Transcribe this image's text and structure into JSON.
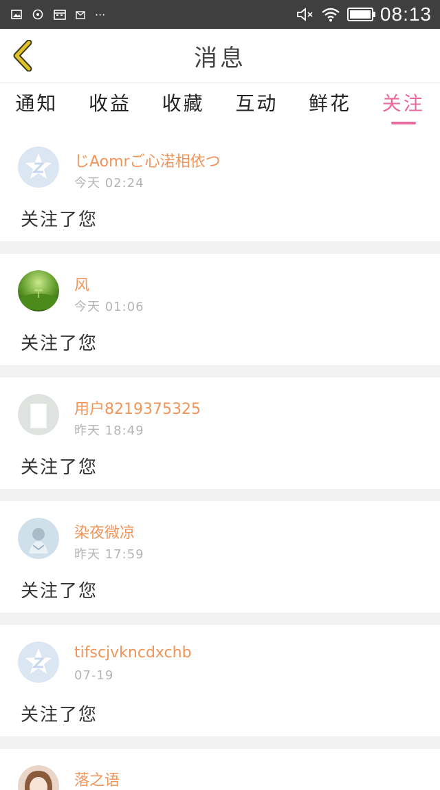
{
  "status_bar": {
    "time": "08:13",
    "left_more": "···"
  },
  "header": {
    "title": "消息"
  },
  "tabs": [
    {
      "label": "通知"
    },
    {
      "label": "收益"
    },
    {
      "label": "收藏"
    },
    {
      "label": "互动"
    },
    {
      "label": "鲜花"
    },
    {
      "label": "关注",
      "active": true
    }
  ],
  "messages": [
    {
      "name": "じAomrご心渃相依つ",
      "time": "今天  02:24",
      "text": "关注了您",
      "avatar": "qq-z-avatar"
    },
    {
      "name": "风",
      "time": "今天  01:06",
      "text": "关注了您",
      "avatar": "grass-avatar"
    },
    {
      "name": "用户8219375325",
      "time": "昨天  18:49",
      "text": "关注了您",
      "avatar": "default-silhouette-avatar"
    },
    {
      "name": "染夜微凉",
      "time": "昨天  17:59",
      "text": "关注了您",
      "avatar": "person-photo-avatar"
    },
    {
      "name": "tifscjvkncdxchb",
      "time": "07-19",
      "text": "关注了您",
      "avatar": "qq-z-avatar"
    },
    {
      "name": "落之语",
      "time": "",
      "text": "",
      "avatar": "girl-photo-avatar"
    }
  ],
  "colors": {
    "accent": "#e86ba0",
    "name": "#f0955a",
    "back": "#e0c22a"
  }
}
